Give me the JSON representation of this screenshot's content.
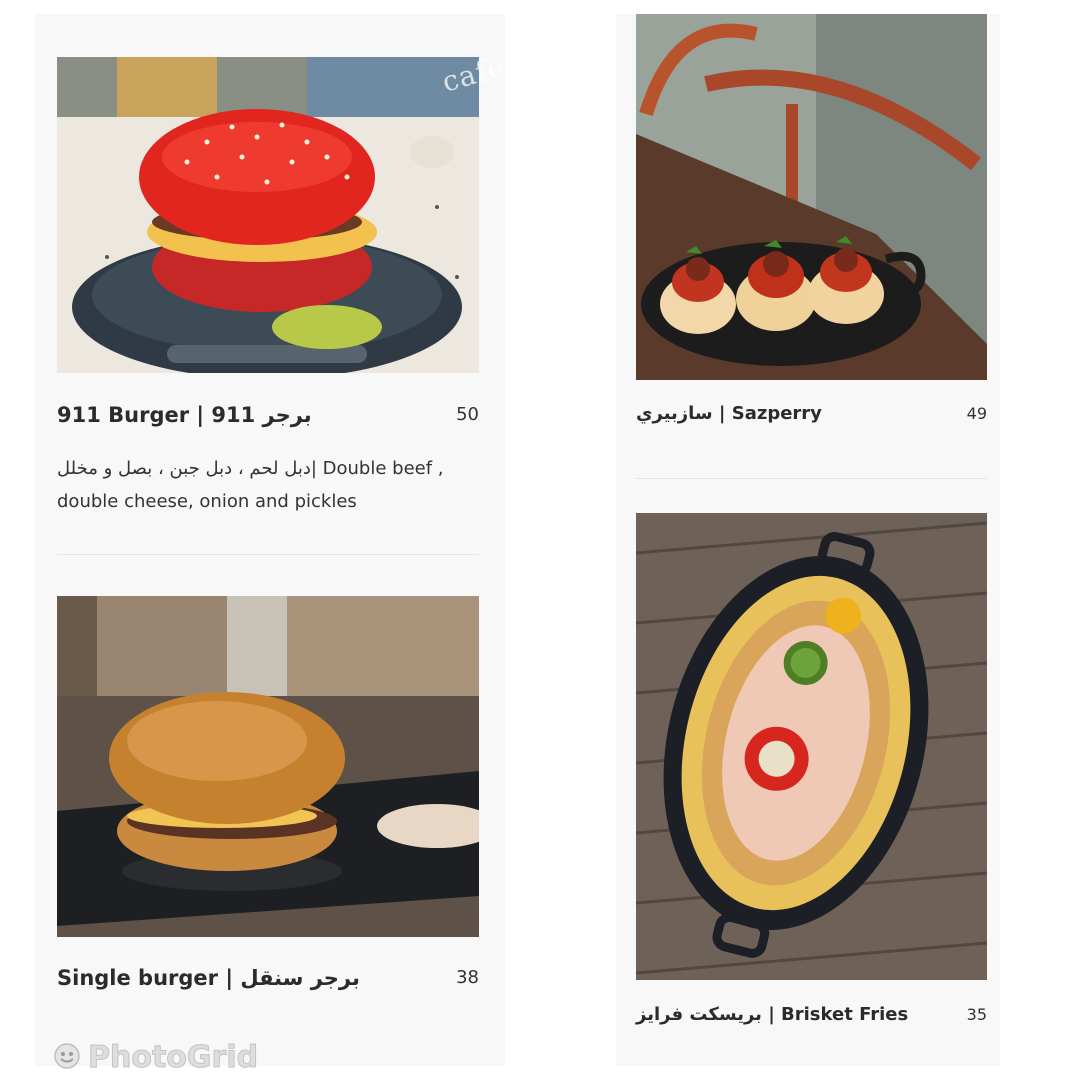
{
  "items": [
    {
      "title": "911 Burger  |  برجر 911",
      "price": "50",
      "description_line1": "دبل لحم ، دبل جبن ، بصل و مخلل| Double beef ,",
      "description_line2": "double cheese, onion and pickles"
    },
    {
      "title": "Single burger  |  برجر سنقل",
      "price": "38"
    },
    {
      "title": "سازبيري | Sazperry",
      "price": "49"
    },
    {
      "title": "بريسكت فرايز | Brisket Fries",
      "price": "35"
    }
  ],
  "watermark": "cafe...com",
  "photogrid": "PhotoGrid",
  "icons": [
    "burger-photo",
    "sazperry-photo",
    "fries-photo",
    "photogrid-logo-icon"
  ]
}
